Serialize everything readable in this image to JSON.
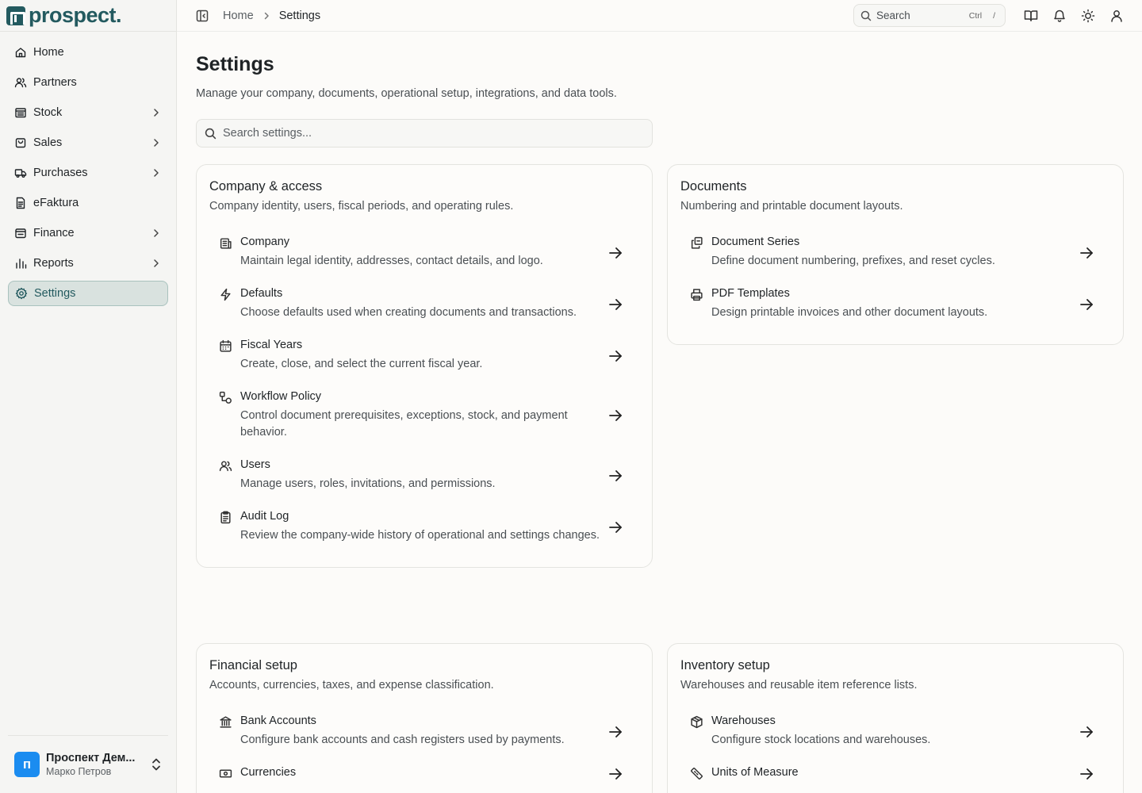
{
  "brand": {
    "name": "prospect."
  },
  "sidebar": {
    "items": [
      {
        "label": "Home",
        "icon": "home-icon",
        "chevron": false,
        "active": false
      },
      {
        "label": "Partners",
        "icon": "users-icon",
        "chevron": false,
        "active": false
      },
      {
        "label": "Stock",
        "icon": "warehouse-icon",
        "chevron": true,
        "active": false
      },
      {
        "label": "Sales",
        "icon": "shopping-bag-icon",
        "chevron": true,
        "active": false
      },
      {
        "label": "Purchases",
        "icon": "truck-icon",
        "chevron": true,
        "active": false
      },
      {
        "label": "eFaktura",
        "icon": "file-text-icon",
        "chevron": false,
        "active": false
      },
      {
        "label": "Finance",
        "icon": "wallet-icon",
        "chevron": true,
        "active": false
      },
      {
        "label": "Reports",
        "icon": "bar-chart-icon",
        "chevron": true,
        "active": false
      },
      {
        "label": "Settings",
        "icon": "gear-icon",
        "chevron": false,
        "active": true
      }
    ],
    "org": {
      "avatar_letter": "п",
      "name": "Проспект Дем...",
      "user": "Марко Петров"
    }
  },
  "topbar": {
    "breadcrumb": {
      "home": "Home",
      "current": "Settings"
    },
    "search": {
      "label": "Search",
      "kbd_ctrl": "Ctrl",
      "kbd_key": "/"
    }
  },
  "page": {
    "title": "Settings",
    "subtitle": "Manage your company, documents, operational setup, integrations, and data tools.",
    "search_placeholder": "Search settings..."
  },
  "sections": [
    {
      "title": "Company & access",
      "desc": "Company identity, users, fiscal periods, and operating rules.",
      "items": [
        {
          "title": "Company",
          "desc": "Maintain legal identity, addresses, contact details, and logo.",
          "icon": "building-icon"
        },
        {
          "title": "Defaults",
          "desc": "Choose defaults used when creating documents and transactions.",
          "icon": "zap-icon"
        },
        {
          "title": "Fiscal Years",
          "desc": "Create, close, and select the current fiscal year.",
          "icon": "calendar-icon"
        },
        {
          "title": "Workflow Policy",
          "desc": "Control document prerequisites, exceptions, stock, and payment behavior.",
          "icon": "workflow-icon"
        },
        {
          "title": "Users",
          "desc": "Manage users, roles, invitations, and permissions.",
          "icon": "users-icon"
        },
        {
          "title": "Audit Log",
          "desc": "Review the company-wide history of operational and settings changes.",
          "icon": "clipboard-icon"
        }
      ]
    },
    {
      "title": "Documents",
      "desc": "Numbering and printable document layouts.",
      "items": [
        {
          "title": "Document Series",
          "desc": "Define document numbering, prefixes, and reset cycles.",
          "icon": "copy-icon"
        },
        {
          "title": "PDF Templates",
          "desc": "Design printable invoices and other document layouts.",
          "icon": "printer-icon"
        }
      ]
    },
    {
      "title": "Financial setup",
      "desc": "Accounts, currencies, taxes, and expense classification.",
      "items": [
        {
          "title": "Bank Accounts",
          "desc": "Configure bank accounts and cash registers used by payments.",
          "icon": "bank-icon"
        },
        {
          "title": "Currencies",
          "desc": "",
          "icon": "banknote-icon"
        }
      ]
    },
    {
      "title": "Inventory setup",
      "desc": "Warehouses and reusable item reference lists.",
      "items": [
        {
          "title": "Warehouses",
          "desc": "Configure stock locations and warehouses.",
          "icon": "package-icon"
        },
        {
          "title": "Units of Measure",
          "desc": "",
          "icon": "ruler-icon"
        }
      ]
    }
  ]
}
